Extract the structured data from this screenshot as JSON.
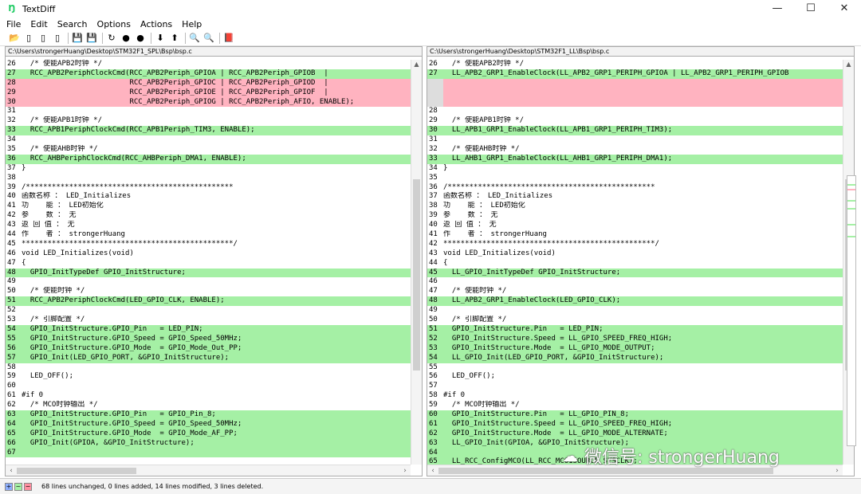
{
  "window": {
    "title": "TextDiff",
    "controls": {
      "minimize": "—",
      "maximize": "☐",
      "close": "✕"
    }
  },
  "menu": [
    {
      "label": "File"
    },
    {
      "label": "Edit"
    },
    {
      "label": "Search"
    },
    {
      "label": "Options"
    },
    {
      "label": "Actions"
    },
    {
      "label": "Help"
    }
  ],
  "toolbar": [
    {
      "name": "open-folder-icon",
      "glyph": "📂"
    },
    {
      "name": "open-left-icon",
      "glyph": "▯"
    },
    {
      "name": "open-right-icon",
      "glyph": "▯"
    },
    {
      "name": "compare-icon",
      "glyph": "▯"
    },
    {
      "name": "save-icon",
      "glyph": "💾"
    },
    {
      "name": "save-as-icon",
      "glyph": "💾"
    },
    {
      "name": "refresh-icon",
      "glyph": "↻"
    },
    {
      "name": "forward-icon",
      "glyph": "●"
    },
    {
      "name": "stop-icon",
      "glyph": "●"
    },
    {
      "name": "next-diff-icon",
      "glyph": "⬇"
    },
    {
      "name": "prev-diff-icon",
      "glyph": "⬆"
    },
    {
      "name": "binoculars-icon",
      "glyph": "🔍"
    },
    {
      "name": "find-next-icon",
      "glyph": "🔍"
    },
    {
      "name": "book-icon",
      "glyph": "📕"
    }
  ],
  "left_pane": {
    "path": "C:\\Users\\strongerHuang\\Desktop\\STM32F1_SPL\\Bsp\\bsp.c",
    "lines": [
      {
        "n": "26",
        "t": "  /* 使能APB2时钟 */",
        "k": "same"
      },
      {
        "n": "27",
        "t": "  RCC_APB2PeriphClockCmd(RCC_APB2Periph_GPIOA | RCC_APB2Periph_GPIOB  |",
        "k": "mod"
      },
      {
        "n": "28",
        "t": "                         RCC_APB2Periph_GPIOC | RCC_APB2Periph_GPIOD  |",
        "k": "del"
      },
      {
        "n": "29",
        "t": "                         RCC_APB2Periph_GPIOE | RCC_APB2Periph_GPIOF  |",
        "k": "del"
      },
      {
        "n": "30",
        "t": "                         RCC_APB2Periph_GPIOG | RCC_APB2Periph_AFIO, ENABLE);",
        "k": "del"
      },
      {
        "n": "31",
        "t": "",
        "k": "same"
      },
      {
        "n": "32",
        "t": "  /* 使能APB1时钟 */",
        "k": "same"
      },
      {
        "n": "33",
        "t": "  RCC_APB1PeriphClockCmd(RCC_APB1Periph_TIM3, ENABLE);",
        "k": "mod"
      },
      {
        "n": "34",
        "t": "",
        "k": "same"
      },
      {
        "n": "35",
        "t": "  /* 使能AHB时钟 */",
        "k": "same"
      },
      {
        "n": "36",
        "t": "  RCC_AHBPeriphClockCmd(RCC_AHBPeriph_DMA1, ENABLE);",
        "k": "mod"
      },
      {
        "n": "37",
        "t": "}",
        "k": "same"
      },
      {
        "n": "38",
        "t": "",
        "k": "same"
      },
      {
        "n": "39",
        "t": "/************************************************",
        "k": "same"
      },
      {
        "n": "40",
        "t": "函数名称 ： LED_Initializes",
        "k": "same"
      },
      {
        "n": "41",
        "t": "功    能 ： LED初始化",
        "k": "same"
      },
      {
        "n": "42",
        "t": "参    数 ： 无",
        "k": "same"
      },
      {
        "n": "43",
        "t": "返 回 值 ： 无",
        "k": "same"
      },
      {
        "n": "44",
        "t": "作    者 ： strongerHuang",
        "k": "same"
      },
      {
        "n": "45",
        "t": "*************************************************/",
        "k": "same"
      },
      {
        "n": "46",
        "t": "void LED_Initializes(void)",
        "k": "same"
      },
      {
        "n": "47",
        "t": "{",
        "k": "same"
      },
      {
        "n": "48",
        "t": "  GPIO_InitTypeDef GPIO_InitStructure;",
        "k": "mod"
      },
      {
        "n": "49",
        "t": "",
        "k": "same"
      },
      {
        "n": "50",
        "t": "  /* 使能时钟 */",
        "k": "same"
      },
      {
        "n": "51",
        "t": "  RCC_APB2PeriphClockCmd(LED_GPIO_CLK, ENABLE);",
        "k": "mod"
      },
      {
        "n": "52",
        "t": "",
        "k": "same"
      },
      {
        "n": "53",
        "t": "  /* 引脚配置 */",
        "k": "same"
      },
      {
        "n": "54",
        "t": "  GPIO_InitStructure.GPIO_Pin   = LED_PIN;",
        "k": "mod"
      },
      {
        "n": "55",
        "t": "  GPIO_InitStructure.GPIO_Speed = GPIO_Speed_50MHz;",
        "k": "mod"
      },
      {
        "n": "56",
        "t": "  GPIO_InitStructure.GPIO_Mode  = GPIO_Mode_Out_PP;",
        "k": "mod"
      },
      {
        "n": "57",
        "t": "  GPIO_Init(LED_GPIO_PORT, &GPIO_InitStructure);",
        "k": "mod"
      },
      {
        "n": "58",
        "t": "",
        "k": "same"
      },
      {
        "n": "59",
        "t": "  LED_OFF();",
        "k": "same"
      },
      {
        "n": "60",
        "t": "",
        "k": "same"
      },
      {
        "n": "61",
        "t": "#if 0",
        "k": "same"
      },
      {
        "n": "62",
        "t": "  /* MCO时钟输出 */",
        "k": "same"
      },
      {
        "n": "63",
        "t": "  GPIO_InitStructure.GPIO_Pin   = GPIO_Pin_8;",
        "k": "mod"
      },
      {
        "n": "64",
        "t": "  GPIO_InitStructure.GPIO_Speed = GPIO_Speed_50MHz;",
        "k": "mod"
      },
      {
        "n": "65",
        "t": "  GPIO_InitStructure.GPIO_Mode  = GPIO_Mode_AF_PP;",
        "k": "mod"
      },
      {
        "n": "66",
        "t": "  GPIO_Init(GPIOA, &GPIO_InitStructure);",
        "k": "mod"
      },
      {
        "n": "67",
        "t": "",
        "k": "mod"
      }
    ]
  },
  "right_pane": {
    "path": "C:\\Users\\strongerHuang\\Desktop\\STM32F1_LL\\Bsp\\bsp.c",
    "lines": [
      {
        "n": "26",
        "t": "  /* 使能APB2时钟 */",
        "k": "same"
      },
      {
        "n": "27",
        "t": "  LL_APB2_GRP1_EnableClock(LL_APB2_GRP1_PERIPH_GPIOA | LL_APB2_GRP1_PERIPH_GPIOB",
        "k": "mod"
      },
      {
        "n": "",
        "t": "",
        "k": "pad"
      },
      {
        "n": "",
        "t": "",
        "k": "pad"
      },
      {
        "n": "",
        "t": "",
        "k": "pad"
      },
      {
        "n": "28",
        "t": "",
        "k": "same"
      },
      {
        "n": "29",
        "t": "  /* 使能APB1时钟 */",
        "k": "same"
      },
      {
        "n": "30",
        "t": "  LL_APB1_GRP1_EnableClock(LL_APB1_GRP1_PERIPH_TIM3);",
        "k": "mod"
      },
      {
        "n": "31",
        "t": "",
        "k": "same"
      },
      {
        "n": "32",
        "t": "  /* 使能AHB时钟 */",
        "k": "same"
      },
      {
        "n": "33",
        "t": "  LL_AHB1_GRP1_EnableClock(LL_AHB1_GRP1_PERIPH_DMA1);",
        "k": "mod"
      },
      {
        "n": "34",
        "t": "}",
        "k": "same"
      },
      {
        "n": "35",
        "t": "",
        "k": "same"
      },
      {
        "n": "36",
        "t": "/************************************************",
        "k": "same"
      },
      {
        "n": "37",
        "t": "函数名称 ： LED_Initializes",
        "k": "same"
      },
      {
        "n": "38",
        "t": "功    能 ： LED初始化",
        "k": "same"
      },
      {
        "n": "39",
        "t": "参    数 ： 无",
        "k": "same"
      },
      {
        "n": "40",
        "t": "返 回 值 ： 无",
        "k": "same"
      },
      {
        "n": "41",
        "t": "作    者 ： strongerHuang",
        "k": "same"
      },
      {
        "n": "42",
        "t": "*************************************************/",
        "k": "same"
      },
      {
        "n": "43",
        "t": "void LED_Initializes(void)",
        "k": "same"
      },
      {
        "n": "44",
        "t": "{",
        "k": "same"
      },
      {
        "n": "45",
        "t": "  LL_GPIO_InitTypeDef GPIO_InitStructure;",
        "k": "mod"
      },
      {
        "n": "46",
        "t": "",
        "k": "same"
      },
      {
        "n": "47",
        "t": "  /* 使能时钟 */",
        "k": "same"
      },
      {
        "n": "48",
        "t": "  LL_APB2_GRP1_EnableClock(LED_GPIO_CLK);",
        "k": "mod"
      },
      {
        "n": "49",
        "t": "",
        "k": "same"
      },
      {
        "n": "50",
        "t": "  /* 引脚配置 */",
        "k": "same"
      },
      {
        "n": "51",
        "t": "  GPIO_InitStructure.Pin   = LED_PIN;",
        "k": "mod"
      },
      {
        "n": "52",
        "t": "  GPIO_InitStructure.Speed = LL_GPIO_SPEED_FREQ_HIGH;",
        "k": "mod"
      },
      {
        "n": "53",
        "t": "  GPIO_InitStructure.Mode  = LL_GPIO_MODE_OUTPUT;",
        "k": "mod"
      },
      {
        "n": "54",
        "t": "  LL_GPIO_Init(LED_GPIO_PORT, &GPIO_InitStructure);",
        "k": "mod"
      },
      {
        "n": "55",
        "t": "",
        "k": "same"
      },
      {
        "n": "56",
        "t": "  LED_OFF();",
        "k": "same"
      },
      {
        "n": "57",
        "t": "",
        "k": "same"
      },
      {
        "n": "58",
        "t": "#if 0",
        "k": "same"
      },
      {
        "n": "59",
        "t": "  /* MCO时钟输出 */",
        "k": "same"
      },
      {
        "n": "60",
        "t": "  GPIO_InitStructure.Pin   = LL_GPIO_PIN_8;",
        "k": "mod"
      },
      {
        "n": "61",
        "t": "  GPIO_InitStructure.Speed = LL_GPIO_SPEED_FREQ_HIGH;",
        "k": "mod"
      },
      {
        "n": "62",
        "t": "  GPIO_InitStructure.Mode  = LL_GPIO_MODE_ALTERNATE;",
        "k": "mod"
      },
      {
        "n": "63",
        "t": "  LL_GPIO_Init(GPIOA, &GPIO_InitStructure);",
        "k": "mod"
      },
      {
        "n": "64",
        "t": "",
        "k": "mod"
      },
      {
        "n": "65",
        "t": "  LL_RCC_ConfigMCO(LL_RCC_MCO1SOURCE_SYSCLK);",
        "k": "mod"
      }
    ]
  },
  "status": {
    "legend": [
      "+",
      "~",
      "−"
    ],
    "text": "68 lines unchanged,  0 lines added, 14 lines modified, 3 lines deleted."
  },
  "watermark": {
    "text": "微信号: strongerHuang"
  },
  "colors": {
    "modified": "#a5f0a5",
    "deleted": "#ffb3c0",
    "added": "#8fb0ff"
  }
}
